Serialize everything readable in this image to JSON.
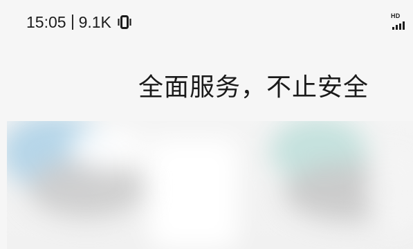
{
  "status_bar": {
    "time": "15:05",
    "network_speed": "9.1K",
    "vibrate_icon": "vibrate-icon",
    "hd_label": "HD",
    "signal_icon": "signal-bars-icon"
  },
  "content": {
    "headline": "全面服务，不止安全"
  }
}
